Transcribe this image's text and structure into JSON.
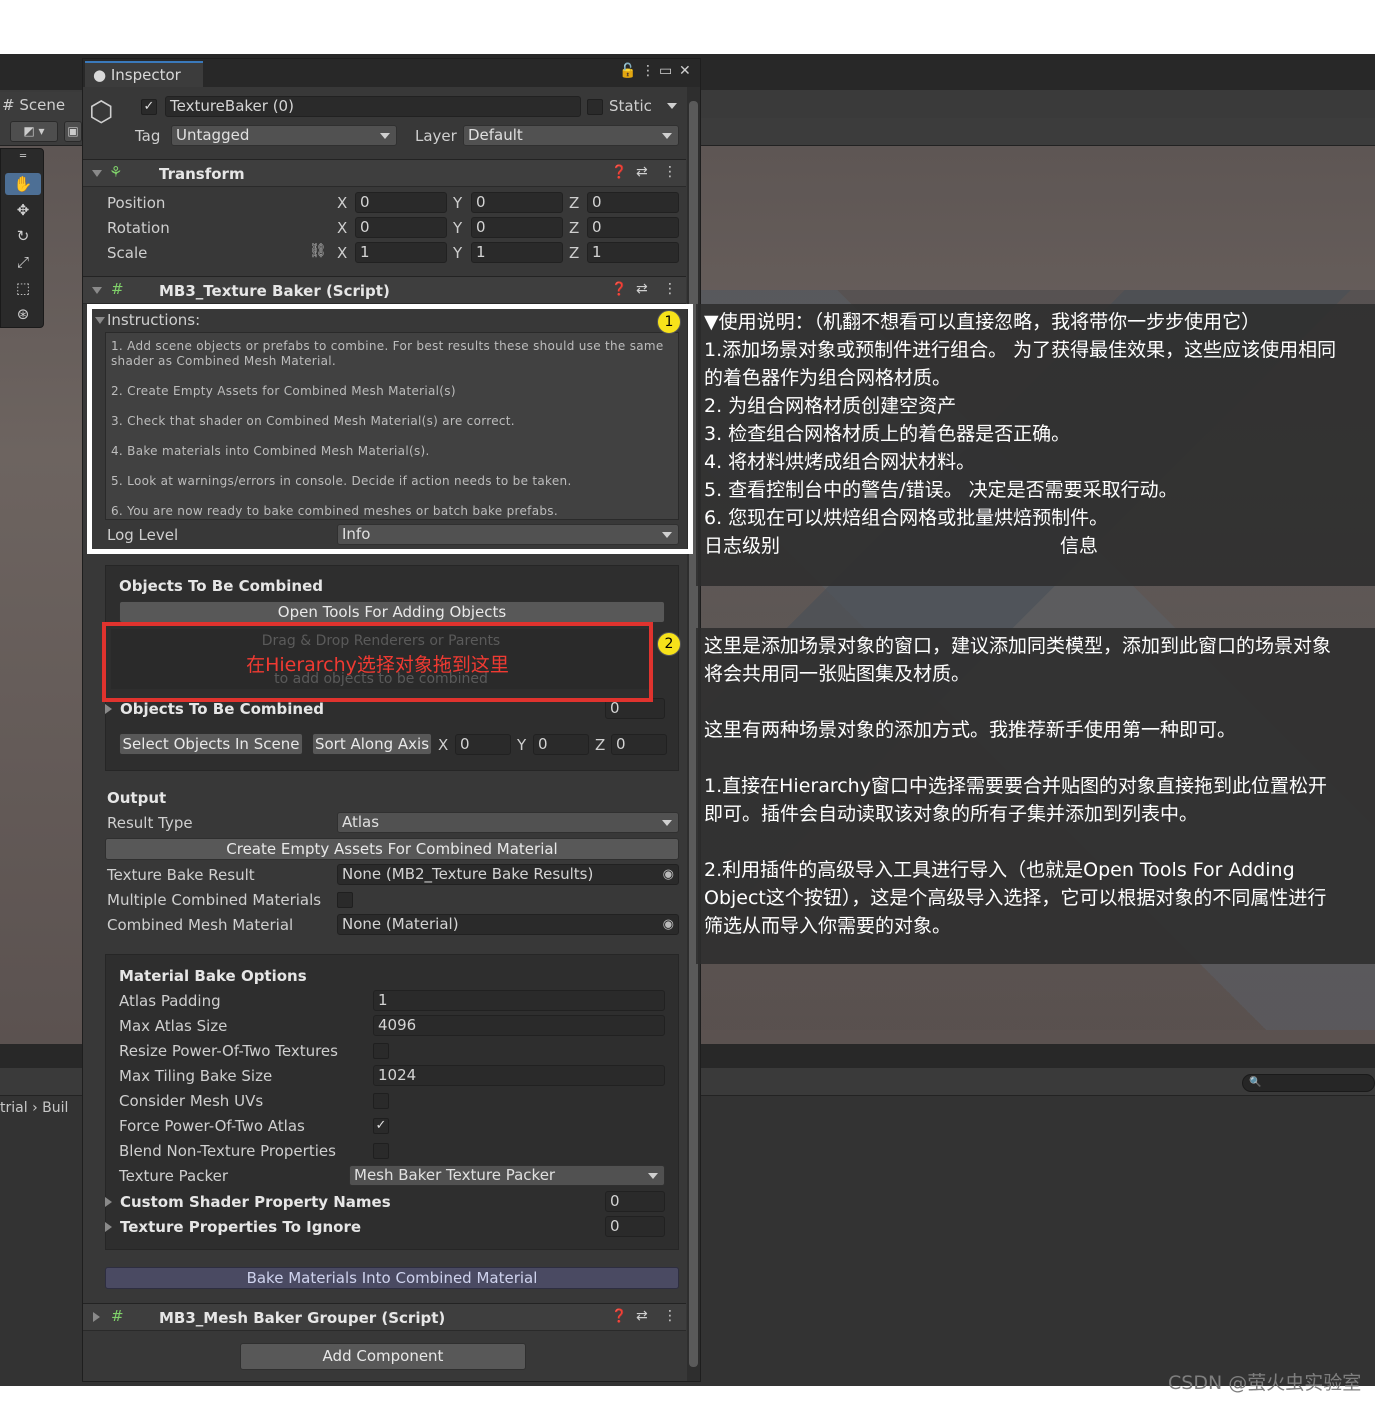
{
  "scene": {
    "tab_label": "Scene",
    "breadcrumb_left": "trial",
    "breadcrumb_right": "Buil"
  },
  "inspector": {
    "tab_label": "Inspector",
    "object": {
      "enabled": true,
      "name": "TextureBaker (0)",
      "static_label": "Static",
      "tag_label": "Tag",
      "tag_value": "Untagged",
      "layer_label": "Layer",
      "layer_value": "Default"
    },
    "transform": {
      "title": "Transform",
      "rows": [
        {
          "label": "Position",
          "x": "0",
          "y": "0",
          "z": "0"
        },
        {
          "label": "Rotation",
          "x": "0",
          "y": "0",
          "z": "0"
        },
        {
          "label": "Scale",
          "x": "1",
          "y": "1",
          "z": "1"
        }
      ],
      "axis_x": "X",
      "axis_y": "Y",
      "axis_z": "Z"
    },
    "texture_baker": {
      "title": "MB3_Texture Baker (Script)",
      "instructions_label": "Instructions:",
      "instructions": [
        "1. Add scene objects or prefabs to combine. For best results these should use the same",
        "shader as Combined Mesh Material.",
        "2. Create Empty Assets for Combined Mesh Material(s)",
        "3. Check that shader on Combined Mesh Material(s) are correct.",
        "4. Bake materials into Combined Mesh Material(s).",
        "5. Look at warnings/errors in console. Decide if action needs to be taken.",
        "6. You are now ready to bake combined meshes or batch bake prefabs."
      ],
      "log_level_label": "Log Level",
      "log_level_value": "Info",
      "objects_section": {
        "title": "Objects To Be Combined",
        "open_tools_button": "Open Tools For Adding Objects",
        "drop_line1": "Drag & Drop Renderers or Parents",
        "drop_line2": "to add objects to be combined",
        "list_label": "Objects To Be Combined",
        "list_count": "0",
        "select_button": "Select Objects In Scene",
        "sort_button": "Sort Along Axis",
        "sort_x": "0",
        "sort_y": "0",
        "sort_z": "0"
      },
      "output": {
        "title": "Output",
        "result_type_label": "Result Type",
        "result_type_value": "Atlas",
        "create_button": "Create Empty Assets For Combined Material",
        "bake_result_label": "Texture Bake Result",
        "bake_result_value": "None (MB2_Texture Bake Results)",
        "multiple_label": "Multiple Combined Materials",
        "multiple_checked": false,
        "combined_mat_label": "Combined Mesh Material",
        "combined_mat_value": "None (Material)"
      },
      "material_options": {
        "title": "Material Bake Options",
        "atlas_padding_label": "Atlas Padding",
        "atlas_padding_value": "1",
        "max_atlas_label": "Max Atlas Size",
        "max_atlas_value": "4096",
        "resize_label": "Resize Power-Of-Two Textures",
        "resize_checked": false,
        "max_tiling_label": "Max Tiling Bake Size",
        "max_tiling_value": "1024",
        "consider_uv_label": "Consider Mesh UVs",
        "consider_uv_checked": false,
        "force_pot_label": "Force Power-Of-Two Atlas",
        "force_pot_checked": true,
        "blend_label": "Blend Non-Texture Properties",
        "blend_checked": false,
        "packer_label": "Texture Packer",
        "packer_value": "Mesh Baker Texture Packer",
        "custom_shader_label": "Custom Shader Property Names",
        "custom_shader_count": "0",
        "ignore_label": "Texture Properties To Ignore",
        "ignore_count": "0"
      },
      "bake_button": "Bake Materials Into Combined Material"
    },
    "grouper": {
      "title": "MB3_Mesh Baker Grouper (Script)"
    },
    "add_component": "Add Component"
  },
  "annotations": {
    "badge1": "1",
    "badge2": "2",
    "red_overlay": "在Hierarchy选择对象拖到这里",
    "note1": [
      "▼使用说明：（机翻不想看可以直接忽略，我将带你一步步使用它）",
      "1.添加场景对象或预制件进行组合。 为了获得最佳效果，这些应该使用相同",
      "的着色器作为组合网格材质。",
      "2. 为组合网格材质创建空资产",
      "3. 检查组合网格材质上的着色器是否正确。",
      "4. 将材料烘烤成组合网状材料。",
      "5. 查看控制台中的警告/错误。 决定是否需要采取行动。",
      "6. 您现在可以烘焙组合网格或批量烘焙预制件。"
    ],
    "note1_log_left": "日志级别",
    "note1_log_right": "信息",
    "note2": [
      "这里是添加场景对象的窗口，建议添加同类模型，添加到此窗口的场景对象",
      "将会共用同一张贴图集及材质。",
      "",
      "这里有两种场景对象的添加方式。我推荐新手使用第一种即可。",
      "",
      "1.直接在Hierarchy窗口中选择需要要合并贴图的对象直接拖到此位置松开",
      "即可。插件会自动读取该对象的所有子集并添加到列表中。",
      "",
      "2.利用插件的高级导入工具进行导入（也就是Open Tools For Adding",
      "Object这个按钮），这是个高级导入选择，它可以根据对象的不同属性进行",
      "筛选从而导入你需要的对象。"
    ],
    "watermark": "CSDN @萤火虫实验室"
  },
  "colors": {
    "highlight_white": "#ffffff",
    "highlight_red": "#e0332e",
    "badge": "#f7e21a",
    "accent_tab": "#3a79bb",
    "bake_button": "#4a4a62"
  }
}
